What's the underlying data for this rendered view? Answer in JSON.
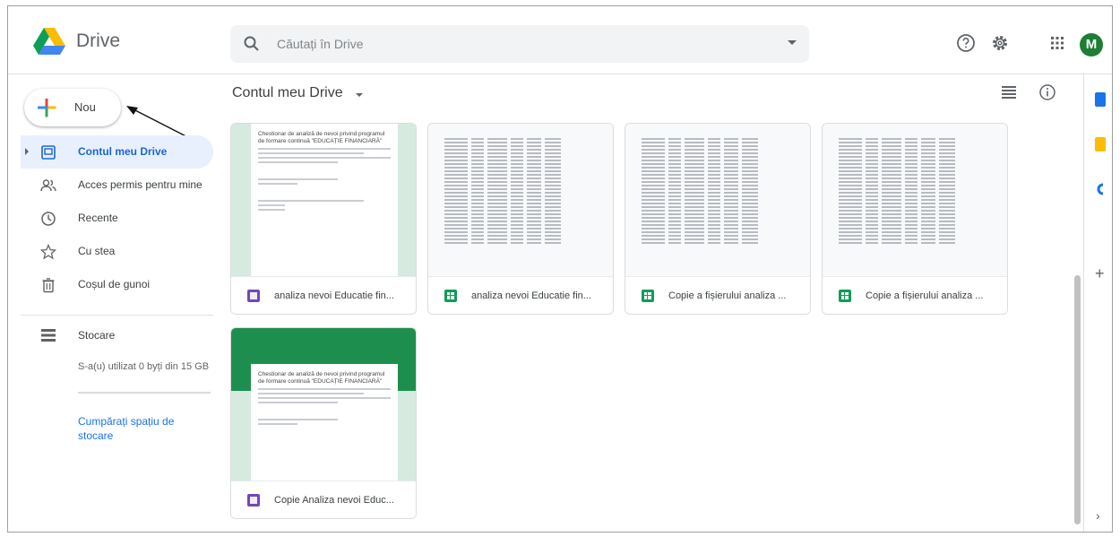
{
  "header": {
    "app_title": "Drive",
    "search_placeholder": "Căutați în Drive",
    "avatar_letter": "M"
  },
  "sidebar": {
    "new_label": "Nou",
    "items": [
      {
        "label": "Contul meu Drive",
        "icon": "my-drive-icon",
        "active": true
      },
      {
        "label": "Acces permis pentru mine",
        "icon": "shared-with-me-icon",
        "active": false
      },
      {
        "label": "Recente",
        "icon": "clock-icon",
        "active": false
      },
      {
        "label": "Cu stea",
        "icon": "star-icon",
        "active": false
      },
      {
        "label": "Coșul de gunoi",
        "icon": "trash-icon",
        "active": false
      }
    ],
    "storage": {
      "label": "Stocare",
      "used_text": "S-a(u) utilizat 0 byți din 15 GB",
      "used_fraction": 0,
      "buy_link": "Cumpărați spațiu de stocare"
    }
  },
  "main": {
    "breadcrumb": "Contul meu Drive",
    "files": [
      {
        "name": "analiza nevoi Educatie fin...",
        "type": "forms",
        "icon": "forms-icon"
      },
      {
        "name": "analiza nevoi Educatie fin...",
        "type": "sheets",
        "icon": "sheets-icon"
      },
      {
        "name": "Copie a fișierului analiza ...",
        "type": "sheets",
        "icon": "sheets-icon"
      },
      {
        "name": "Copie a fișierului analiza ...",
        "type": "sheets",
        "icon": "sheets-icon"
      },
      {
        "name": "Copie Analiza nevoi Educ...",
        "type": "forms",
        "icon": "forms-icon"
      }
    ],
    "form_preview_title": "Chestionar de analiză de nevoi privind programul de formare continuă \"EDUCAȚIE FINANCIARĂ\""
  },
  "colors": {
    "accent_blue": "#1a73e8",
    "forms_purple": "#7248b9",
    "sheets_green": "#0f9d58",
    "avatar_green": "#1e7e34"
  }
}
